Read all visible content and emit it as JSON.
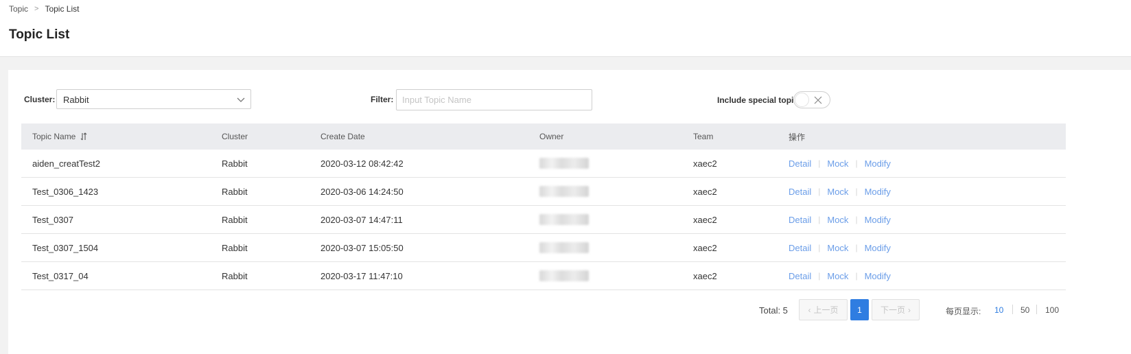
{
  "breadcrumb": {
    "root": "Topic",
    "separator": ">",
    "current": "Topic List"
  },
  "page": {
    "title": "Topic List"
  },
  "filters": {
    "cluster_label": "Cluster:",
    "cluster_value": "Rabbit",
    "filter_label": "Filter:",
    "filter_placeholder": "Input Topic Name",
    "filter_value": "",
    "special_label": "Include special topic:",
    "special_enabled": false
  },
  "table": {
    "columns": [
      "Topic Name",
      "Cluster",
      "Create Date",
      "Owner",
      "Team",
      "操作"
    ],
    "rows": [
      {
        "topic": "aiden_creatTest2",
        "cluster": "Rabbit",
        "date": "2020-03-12 08:42:42",
        "owner": "",
        "team": "xaec2"
      },
      {
        "topic": "Test_0306_1423",
        "cluster": "Rabbit",
        "date": "2020-03-06 14:24:50",
        "owner": "",
        "team": "xaec2"
      },
      {
        "topic": "Test_0307",
        "cluster": "Rabbit",
        "date": "2020-03-07 14:47:11",
        "owner": "",
        "team": "xaec2"
      },
      {
        "topic": "Test_0307_1504",
        "cluster": "Rabbit",
        "date": "2020-03-07 15:05:50",
        "owner": "",
        "team": "xaec2"
      },
      {
        "topic": "Test_0317_04",
        "cluster": "Rabbit",
        "date": "2020-03-17 11:47:10",
        "owner": "",
        "team": "xaec2"
      }
    ],
    "actions": {
      "detail": "Detail",
      "mock": "Mock",
      "modify": "Modify"
    }
  },
  "pagination": {
    "total": "Total: 5",
    "prev": "上一页",
    "next": "下一页",
    "current_page": "1",
    "per_page_label": "每页显示:",
    "sizes": [
      "10",
      "50",
      "100"
    ],
    "active_size": "10"
  },
  "colors": {
    "accent": "#2f7de1",
    "link": "#6a9de8",
    "header_bg": "#ebecef"
  },
  "icons": {
    "sort": "sort-icon",
    "chevron": "chevron-down-icon",
    "toggle_off": "close-icon"
  }
}
